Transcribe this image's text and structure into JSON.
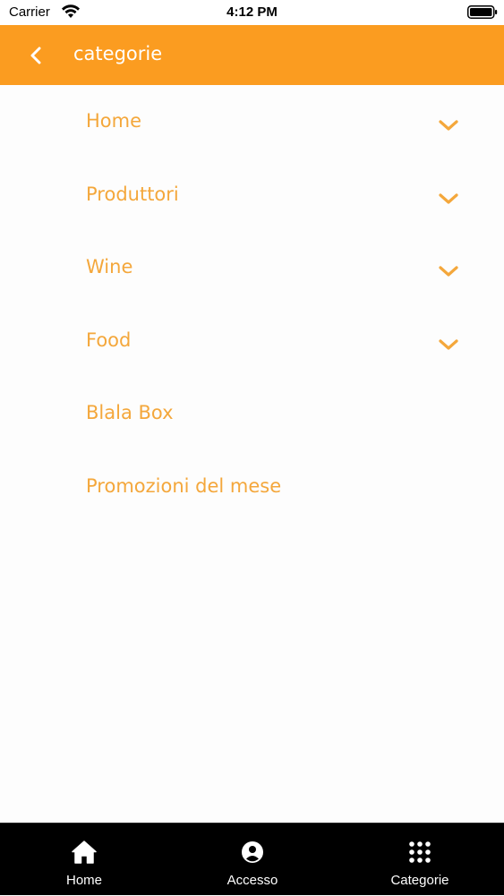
{
  "status_bar": {
    "carrier": "Carrier",
    "time": "4:12 PM",
    "wifi_icon": "wifi-icon",
    "battery_icon": "battery-icon"
  },
  "header": {
    "title": "categorie",
    "back_icon": "chevron-left-icon",
    "background_color": "#fb9c20"
  },
  "menu": {
    "item_color": "#f4a73b",
    "items": [
      {
        "label": "Home",
        "expandable": true
      },
      {
        "label": "Produttori",
        "expandable": true
      },
      {
        "label": "Wine",
        "expandable": true
      },
      {
        "label": "Food",
        "expandable": true
      },
      {
        "label": "Blala Box",
        "expandable": false
      },
      {
        "label": "Promozioni del mese",
        "expandable": false
      }
    ]
  },
  "tab_bar": {
    "background_color": "#000000",
    "tabs": [
      {
        "label": "Home",
        "icon": "home-icon"
      },
      {
        "label": "Accesso",
        "icon": "user-circle-icon"
      },
      {
        "label": "Categorie",
        "icon": "grid-dots-icon"
      }
    ]
  }
}
